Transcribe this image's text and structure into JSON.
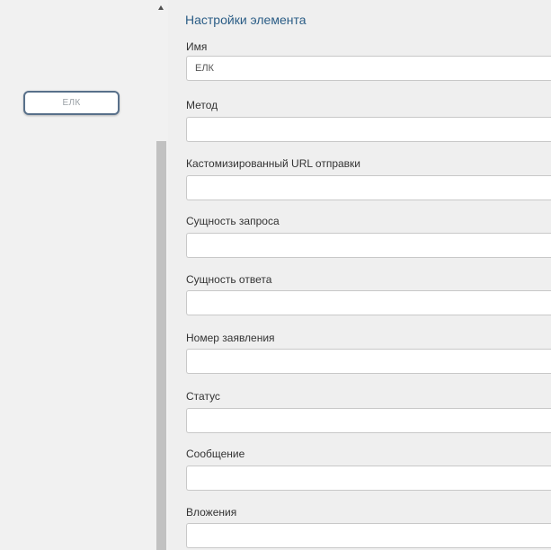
{
  "canvas": {
    "node_label": "ЕЛК"
  },
  "panel": {
    "title": "Настройки элемента",
    "fields": [
      {
        "label": "Имя",
        "value": "ЕЛК"
      },
      {
        "label": "Метод",
        "value": ""
      },
      {
        "label": "Кастомизированный URL отправки",
        "value": ""
      },
      {
        "label": "Сущность запроса",
        "value": ""
      },
      {
        "label": "Сущность ответа",
        "value": ""
      },
      {
        "label": "Номер заявления",
        "value": ""
      },
      {
        "label": "Статус",
        "value": ""
      },
      {
        "label": "Сообщение",
        "value": ""
      },
      {
        "label": "Вложения",
        "value": ""
      }
    ]
  }
}
